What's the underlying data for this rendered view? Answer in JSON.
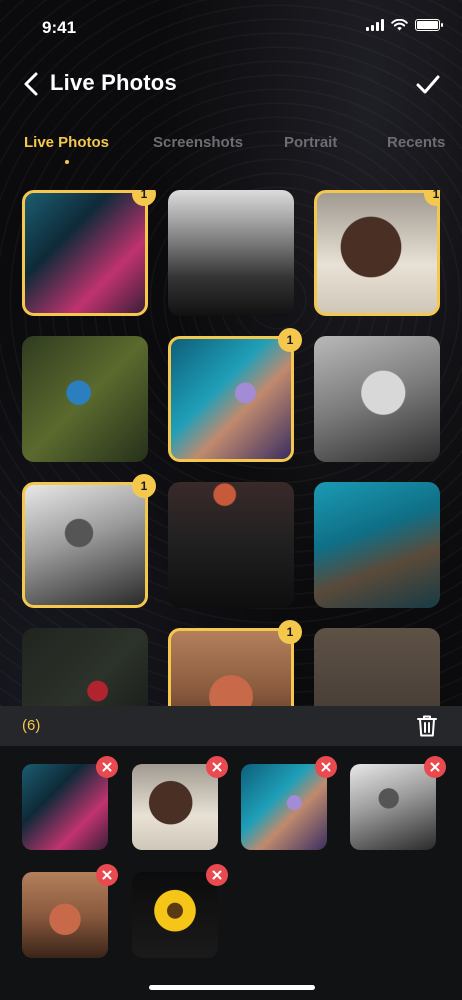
{
  "status": {
    "time": "9:41"
  },
  "header": {
    "title": "Live Photos"
  },
  "tabs": [
    {
      "label": "Live Photos",
      "active": true
    },
    {
      "label": "Screenshots",
      "active": false
    },
    {
      "label": "Portrait",
      "active": false
    },
    {
      "label": "Recents",
      "active": false
    }
  ],
  "grid": [
    {
      "photo": "girl-neon",
      "selected": true,
      "badge": "1"
    },
    {
      "photo": "bridge",
      "selected": false,
      "badge": ""
    },
    {
      "photo": "dog",
      "selected": true,
      "badge": "1"
    },
    {
      "photo": "bird",
      "selected": false,
      "badge": ""
    },
    {
      "photo": "bubble",
      "selected": true,
      "badge": "1"
    },
    {
      "photo": "bw-woman",
      "selected": false,
      "badge": ""
    },
    {
      "photo": "car",
      "selected": true,
      "badge": "1"
    },
    {
      "photo": "sunset",
      "selected": false,
      "badge": ""
    },
    {
      "photo": "sea",
      "selected": false,
      "badge": ""
    },
    {
      "photo": "flowers",
      "selected": false,
      "badge": ""
    },
    {
      "photo": "redhead",
      "selected": true,
      "badge": "1"
    },
    {
      "photo": "still",
      "selected": false,
      "badge": ""
    }
  ],
  "selection": {
    "count_label": "(6)",
    "items": [
      "girl-neon",
      "dog",
      "bubble",
      "car",
      "redhead",
      "sunflower"
    ]
  },
  "colors": {
    "accent": "#f4c84d",
    "remove": "#e84a50",
    "bar": "#26272a"
  }
}
